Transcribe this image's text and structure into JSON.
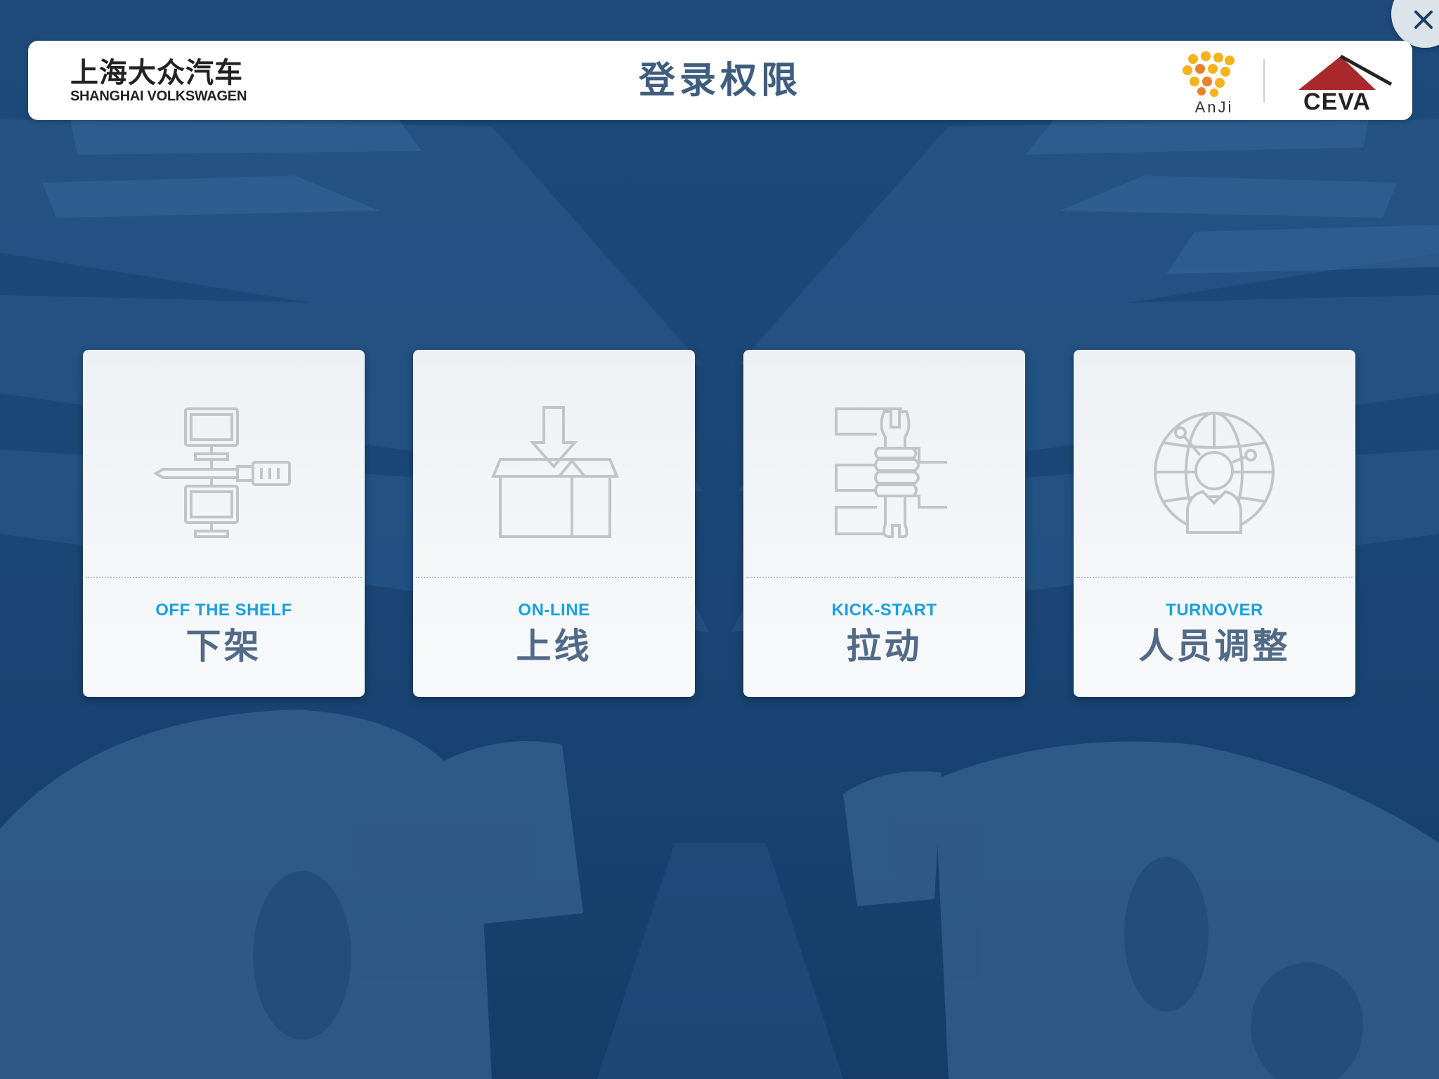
{
  "header": {
    "brand_cn": "上海大众汽车",
    "brand_en": "SHANGHAI VOLKSWAGEN",
    "title": "登录权限",
    "partner_logo_1": "AnJi",
    "partner_logo_2": "CEVA"
  },
  "close_button": {
    "icon": "close-icon"
  },
  "cards": [
    {
      "en": "OFF THE SHELF",
      "cn": "下架",
      "icon": "screwdriver-computers-icon"
    },
    {
      "en": "ON-LINE",
      "cn": "上线",
      "icon": "box-download-icon"
    },
    {
      "en": "KICK-START",
      "cn": "拉动",
      "icon": "hand-wrench-icon"
    },
    {
      "en": "TURNOVER",
      "cn": "人员调整",
      "icon": "globe-person-icon"
    }
  ],
  "colors": {
    "background": "#1a4574",
    "title": "#3f5d7e",
    "card_label_en": "#1aa1dc",
    "card_label_cn": "#526a86",
    "icon_stroke": "#c2c4c7",
    "ceva_red": "#a8282c"
  }
}
